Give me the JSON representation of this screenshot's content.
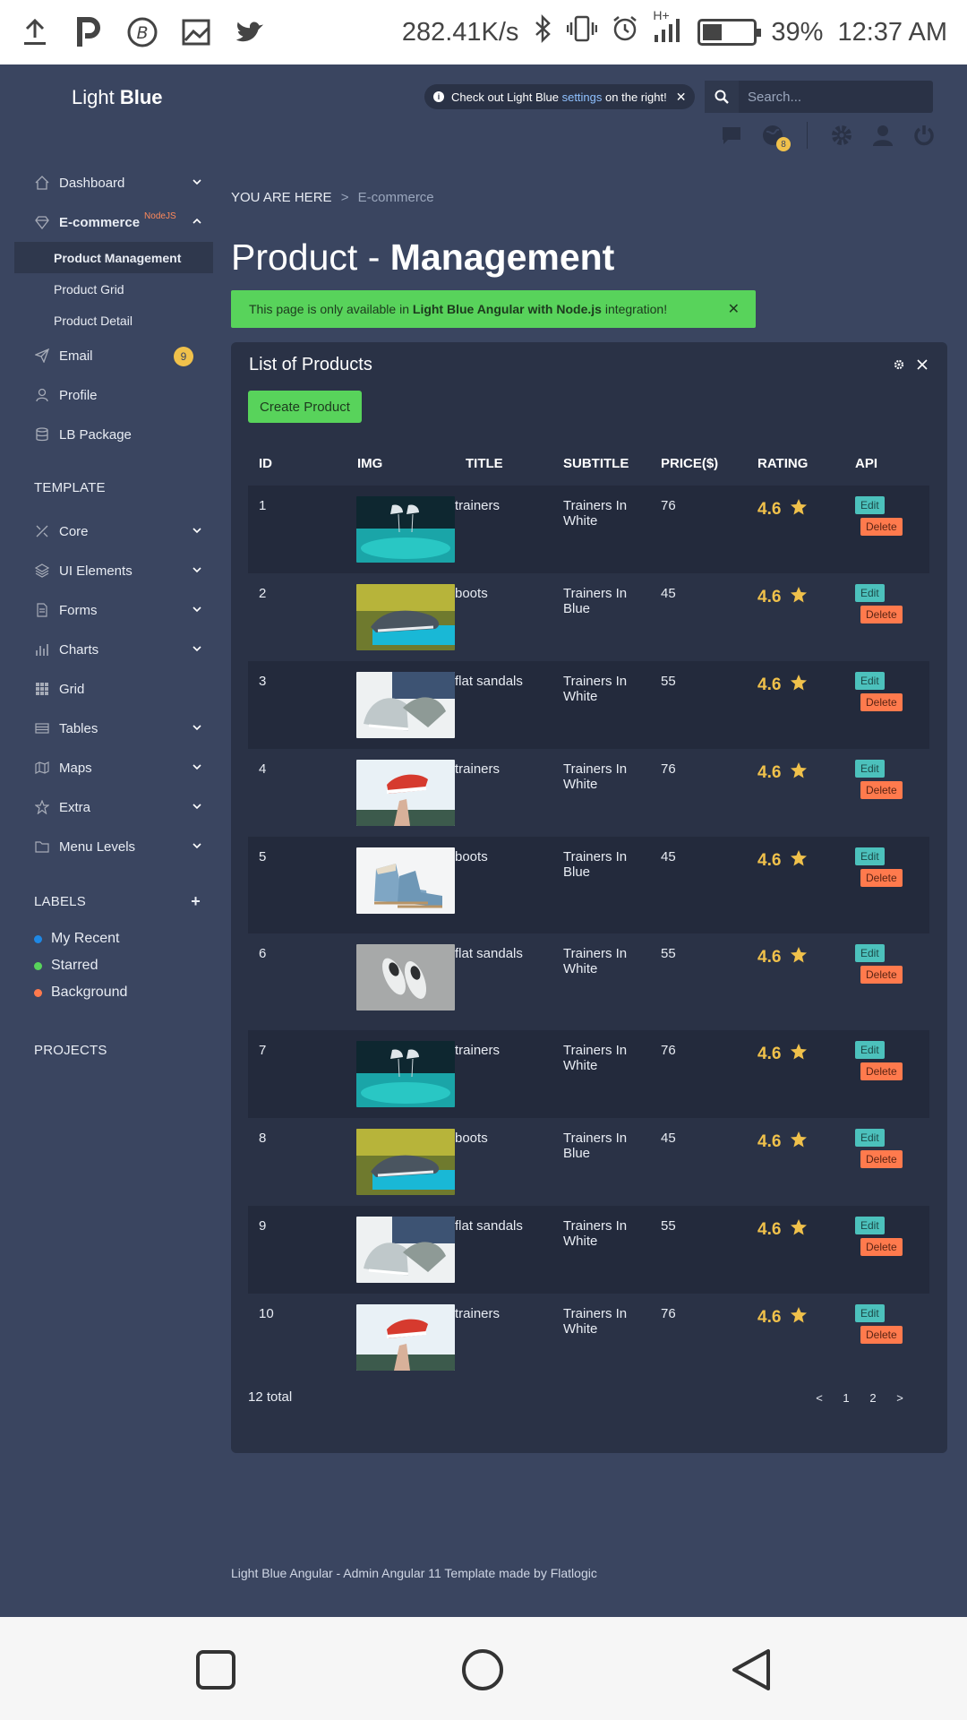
{
  "status_bar": {
    "speed": "282.41K/s",
    "battery_pct": "39%",
    "battery_level": 0.39,
    "time": "12:37 AM",
    "network": "H+"
  },
  "app": {
    "logo_light": "Light",
    "logo_bold": "Blue",
    "notice": {
      "prefix": "Check out Light Blue",
      "link": "settings",
      "suffix": "on the right!",
      "close": "✕"
    },
    "search_placeholder": "Search...",
    "notifications_badge": "8"
  },
  "sidebar": {
    "dashboard": "Dashboard",
    "ecommerce": "E-commerce",
    "ecommerce_tag": "NodeJS",
    "sub_items": [
      "Product Management",
      "Product Grid",
      "Product Detail"
    ],
    "email": "Email",
    "email_count": "9",
    "profile": "Profile",
    "lb_package": "LB Package",
    "template_title": "TEMPLATE",
    "template_items": [
      "Core",
      "UI Elements",
      "Forms",
      "Charts",
      "Grid",
      "Tables",
      "Maps",
      "Extra",
      "Menu Levels"
    ],
    "labels_title": "LABELS",
    "labels_add": "+",
    "labels": [
      {
        "text": "My Recent",
        "color": "#1e88e5"
      },
      {
        "text": "Starred",
        "color": "#58d35b"
      },
      {
        "text": "Background",
        "color": "#ff7a4d"
      }
    ],
    "projects_title": "PROJECTS"
  },
  "breadcrumb": {
    "prefix": "YOU ARE HERE",
    "separator": ">",
    "current": "E-commerce"
  },
  "page_title": {
    "light": "Product - ",
    "bold": "Management"
  },
  "alert": {
    "prefix": "This page is only available in ",
    "bold": "Light Blue Angular with Node.js",
    "suffix": " integration!",
    "close": "✕"
  },
  "panel": {
    "title": "List of Products",
    "create_label": "Create Product",
    "headers": [
      "ID",
      "IMG",
      "TITLE",
      "SUBTITLE",
      "PRICE($)",
      "RATING",
      "API"
    ],
    "edit_label": "Edit",
    "delete_label": "Delete",
    "rows": [
      {
        "id": "1",
        "title": "trainers",
        "subtitle": "Trainers In White",
        "price": "76",
        "rating": "4.6",
        "img": "jumping-sneakers"
      },
      {
        "id": "2",
        "title": "boots",
        "subtitle": "Trainers In Blue",
        "price": "45",
        "rating": "4.6",
        "img": "shoe-on-blue-box"
      },
      {
        "id": "3",
        "title": "flat sandals",
        "subtitle": "Trainers In White",
        "price": "55",
        "rating": "4.6",
        "img": "white-sneakers-jeans"
      },
      {
        "id": "4",
        "title": "trainers",
        "subtitle": "Trainers In White",
        "price": "76",
        "rating": "4.6",
        "img": "red-sneaker-in-hand"
      },
      {
        "id": "5",
        "title": "boots",
        "subtitle": "Trainers In Blue",
        "price": "45",
        "rating": "4.6",
        "img": "blue-boots"
      },
      {
        "id": "6",
        "title": "flat sandals",
        "subtitle": "Trainers In White",
        "price": "55",
        "rating": "4.6",
        "img": "white-sneakers-top"
      },
      {
        "id": "7",
        "title": "trainers",
        "subtitle": "Trainers In White",
        "price": "76",
        "rating": "4.6",
        "img": "jumping-sneakers"
      },
      {
        "id": "8",
        "title": "boots",
        "subtitle": "Trainers In Blue",
        "price": "45",
        "rating": "4.6",
        "img": "shoe-on-blue-box"
      },
      {
        "id": "9",
        "title": "flat sandals",
        "subtitle": "Trainers In White",
        "price": "55",
        "rating": "4.6",
        "img": "white-sneakers-jeans"
      },
      {
        "id": "10",
        "title": "trainers",
        "subtitle": "Trainers In White",
        "price": "76",
        "rating": "4.6",
        "img": "red-sneaker-in-hand"
      }
    ],
    "total": "12 total",
    "pager": {
      "prev": "<",
      "pages": [
        "1",
        "2"
      ],
      "next": ">"
    }
  },
  "footer": "Light Blue Angular - Admin Angular 11 Template made by Flatlogic",
  "colors": {
    "background": "#3a4560",
    "panel": "#2a3246",
    "accent_green": "#58d35b",
    "accent_yellow": "#f0c14b",
    "edit_teal": "#4cc1bc",
    "delete_orange": "#ff7a4d"
  }
}
